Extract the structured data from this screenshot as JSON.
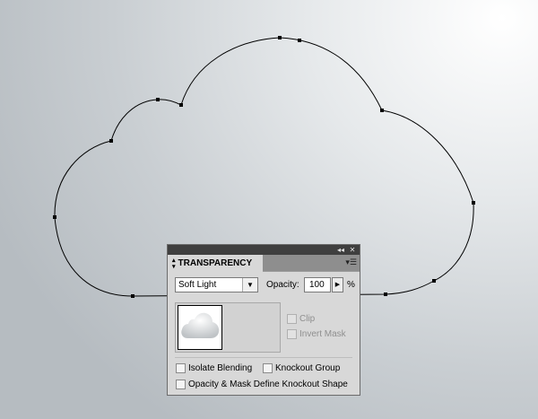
{
  "panel": {
    "title": "TRANSPARENCY",
    "collapse_icon": "double-chevron-left-icon",
    "close_icon": "close-icon",
    "menu_icon": "panel-menu-icon",
    "blend_mode": {
      "value": "Soft Light"
    },
    "opacity": {
      "label": "Opacity:",
      "value": "100",
      "unit": "%"
    },
    "mask_options": {
      "clip_label": "Clip",
      "invert_mask_label": "Invert Mask"
    },
    "options": {
      "isolate_blending_label": "Isolate Blending",
      "knockout_group_label": "Knockout Group",
      "opacity_mask_label": "Opacity & Mask Define Knockout Shape"
    }
  },
  "colors": {
    "panel_bg": "#d8d8d8",
    "topbar": "#3f3f3f",
    "tabrow": "#8e8e8e",
    "path_stroke": "#000000"
  }
}
